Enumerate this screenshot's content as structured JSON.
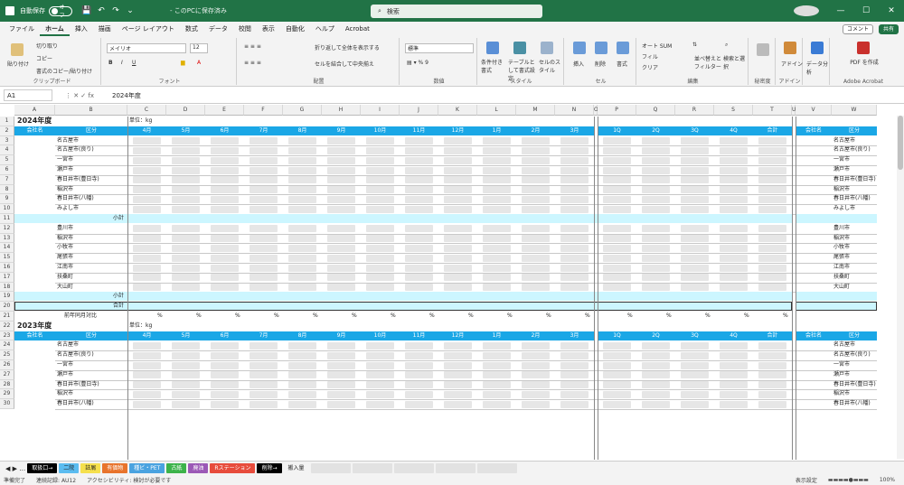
{
  "titlebar": {
    "autosave_label": "自動保存",
    "toggle_state": "オフ",
    "file_name": "- このPCに保存済み",
    "search_placeholder": "検索"
  },
  "menu": {
    "tabs": [
      "ファイル",
      "ホーム",
      "挿入",
      "描画",
      "ページ レイアウト",
      "数式",
      "データ",
      "校閲",
      "表示",
      "自動化",
      "ヘルプ",
      "Acrobat"
    ],
    "comments": "コメント",
    "share": "共有"
  },
  "ribbon": {
    "clipboard": {
      "paste": "貼り付け",
      "cut": "切り取り",
      "copy": "コピー",
      "format_painter": "書式のコピー/貼り付け",
      "label": "クリップボード"
    },
    "font": {
      "name": "メイリオ",
      "size": "12",
      "label": "フォント"
    },
    "alignment": {
      "wrap": "折り返して全体を表示する",
      "merge": "セルを結合して中央揃え",
      "label": "配置"
    },
    "number": {
      "format": "標準",
      "label": "数値"
    },
    "style": {
      "cond": "条件付き書式",
      "table": "テーブルとして書式設定",
      "cell": "セルのスタイル",
      "label": "スタイル"
    },
    "cells": {
      "insert": "挿入",
      "delete": "削除",
      "format": "書式",
      "label": "セル"
    },
    "editing": {
      "autosum": "オート SUM",
      "fill": "フィル",
      "clear": "クリア",
      "sort": "並べ替えとフィルター",
      "find": "検索と選択",
      "label": "編集"
    },
    "sensitivity": {
      "label": "秘密度"
    },
    "addins": {
      "label": "アドイン",
      "btn": "アドイン"
    },
    "analysis": {
      "btn": "データ分析"
    },
    "acrobat": {
      "btn": "PDF を作成",
      "label": "Adobe Acrobat"
    }
  },
  "formula": {
    "namebox": "A1",
    "value": "2024年度"
  },
  "columns": [
    "A",
    "B",
    "C",
    "D",
    "E",
    "F",
    "G",
    "H",
    "I",
    "J",
    "K",
    "L",
    "M",
    "N",
    "O",
    "P",
    "Q",
    "R",
    "S",
    "T",
    "U",
    "V",
    "W"
  ],
  "sheet": {
    "title2024": "2024年度",
    "unit": "単位：kg",
    "headers": [
      "会社名",
      "区分",
      "4月",
      "5月",
      "6月",
      "7月",
      "8月",
      "9月",
      "10月",
      "11月",
      "12月",
      "1月",
      "2月",
      "3月",
      "1Q",
      "2Q",
      "3Q",
      "4Q",
      "合計",
      "会社名",
      "区分"
    ],
    "group1": [
      "名古屋市",
      "名古屋市(良り)",
      "一宮市",
      "瀬戸市",
      "春日井市(豊日寺)",
      "稲沢市",
      "春日井市(八幡)",
      "みよし市"
    ],
    "group2": [
      "豊川市",
      "稲沢市",
      "小牧市",
      "尾張市",
      "江南市",
      "扶桑町",
      "大山町"
    ],
    "group1v": [
      "名古屋市",
      "名古屋市(良り)",
      "一宮市",
      "瀬戸市",
      "春日井市(豊日寺)",
      "稲沢市",
      "春日井市(八幡)",
      "みよし市"
    ],
    "group2v": [
      "豊川市",
      "稲沢市",
      "小牧市",
      "尾張市",
      "江南市",
      "扶桑町",
      "大山町"
    ],
    "subtotal": "小計",
    "total": "合計",
    "yoy": "前年同月対比",
    "title2023": "2023年度",
    "group2023": [
      "名古屋市",
      "名古屋市(良り)",
      "一宮市",
      "瀬戸市",
      "春日井市(豊日寺)",
      "稲沢市",
      "春日井市(八幡)"
    ]
  },
  "sheettabs": [
    "取扱口→",
    "二院",
    "註屑",
    "有価物",
    "種ビ・PET",
    "古紙",
    "廃油",
    "Rステーション",
    "削除→",
    "搬入量"
  ],
  "sheettab_colors": [
    "#000000",
    "#5bbcf0",
    "#f5e04d",
    "#e8742c",
    "#4aa3e0",
    "#3cb34a",
    "#9b59b6",
    "#e74c3c",
    "#000000",
    "#f3f3f3"
  ],
  "status": {
    "ready": "準備完了",
    "macro": "連続記録: AU12",
    "accessibility": "アクセシビリティ: 検討が必要です",
    "view": "表示設定",
    "zoom": "100%"
  }
}
